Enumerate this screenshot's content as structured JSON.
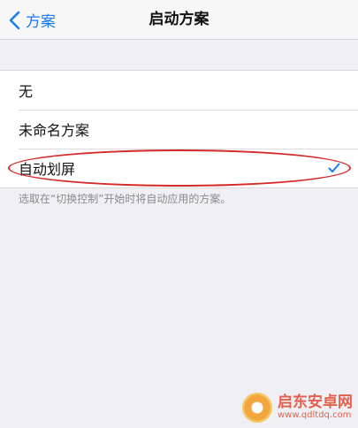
{
  "nav": {
    "back_label": "方案",
    "title": "启动方案"
  },
  "options": [
    {
      "label": "无",
      "selected": false
    },
    {
      "label": "未命名方案",
      "selected": false
    },
    {
      "label": "自动划屏",
      "selected": true
    }
  ],
  "footnote": "选取在“切换控制”开始时将自动应用的方案。",
  "watermark": {
    "name": "启东安卓网",
    "url": "www.qdltdq.com"
  },
  "colors": {
    "accent": "#1a7cf5",
    "annotation": "#d42a2a",
    "background": "#efeff4"
  }
}
